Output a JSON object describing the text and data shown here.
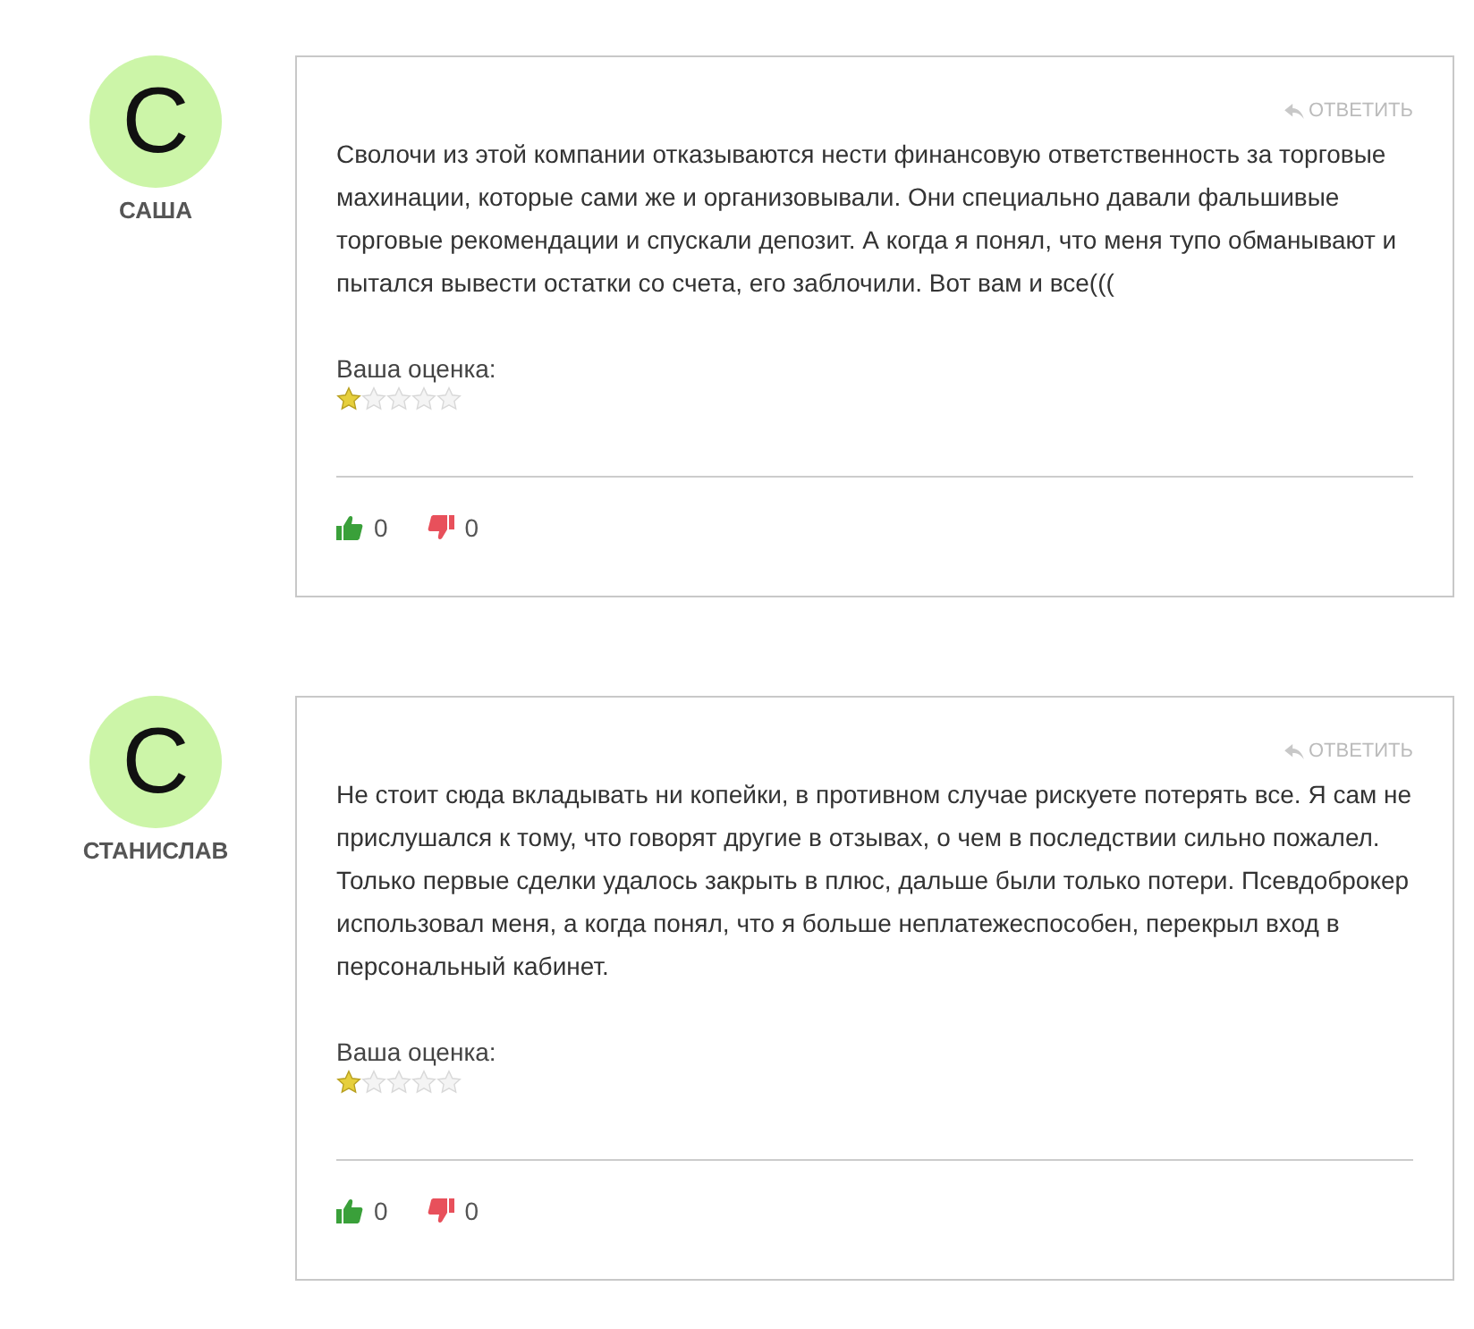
{
  "reviews": [
    {
      "avatar_letter": "С",
      "author": "САША",
      "reply": "ОТВЕТИТЬ",
      "text": "Сволочи из этой компании отказываются нести финансовую ответственность за торговые махинации, которые сами же и организовывали. Они специально давали фальшивые торговые рекомендации и спускали депозит. А когда я понял, что меня тупо обманывают и пытался вывести остатки со счета, его заблочили. Вот вам и все(((",
      "rating_label": "Ваша оценка:",
      "stars": 1,
      "likes": "0",
      "dislikes": "0"
    },
    {
      "avatar_letter": "С",
      "author": "СТАНИСЛАВ",
      "reply": "ОТВЕТИТЬ",
      "text": "Не стоит сюда вкладывать ни копейки, в противном случае рискуете потерять все. Я сам не прислушался к тому, что говорят другие в отзывах, о чем в последствии сильно пожалел. Только первые сделки удалось закрыть в плюс, дальше были только потери. Псевдоброкер использовал меня, а когда понял, что я больше неплатежеспособен, перекрыл вход в персональный кабинет.",
      "rating_label": "Ваша оценка:",
      "stars": 1,
      "likes": "0",
      "dislikes": "0"
    }
  ]
}
